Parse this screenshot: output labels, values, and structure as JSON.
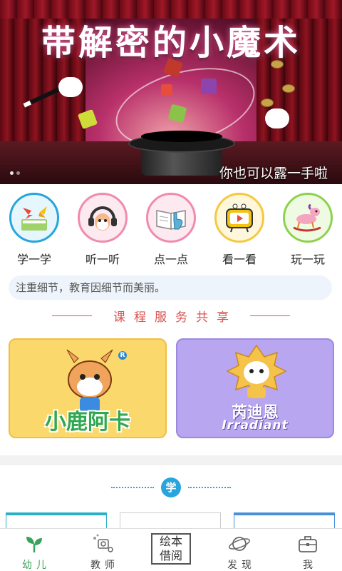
{
  "banner": {
    "title": "带解密的小魔术",
    "caption": "你也可以露一手啦",
    "dots": 2
  },
  "categories": [
    {
      "label": "学一学",
      "icon": "butterfly-book-icon",
      "color": "#27a5dc"
    },
    {
      "label": "听一听",
      "icon": "headphones-deer-icon",
      "color": "#f08bb0"
    },
    {
      "label": "点一点",
      "icon": "pointing-book-icon",
      "color": "#f08bb0"
    },
    {
      "label": "看一看",
      "icon": "tv-play-icon",
      "color": "#f5c842"
    },
    {
      "label": "玩一玩",
      "icon": "rocking-horse-icon",
      "color": "#8fd14f"
    }
  ],
  "notice": "注重细节，教育因细节而美丽。",
  "section": {
    "title": "课程服务共享"
  },
  "cards": [
    {
      "brand": "小鹿阿卡",
      "badge": "R",
      "color": "#fbd86b"
    },
    {
      "brand": "芮迪恩",
      "sub": "Irradiant",
      "color": "#b9a6f0"
    }
  ],
  "learn": {
    "badge": "学"
  },
  "tabs": [
    {
      "label": "幼儿",
      "icon": "sprout-icon",
      "active": true
    },
    {
      "label": "教师",
      "icon": "teacher-icon",
      "active": false
    },
    {
      "label1": "绘本",
      "label2": "借阅",
      "icon": "picture-book-box",
      "active": false
    },
    {
      "label": "发现",
      "icon": "planet-icon",
      "active": false
    },
    {
      "label": "我",
      "icon": "briefcase-icon",
      "active": false
    }
  ]
}
